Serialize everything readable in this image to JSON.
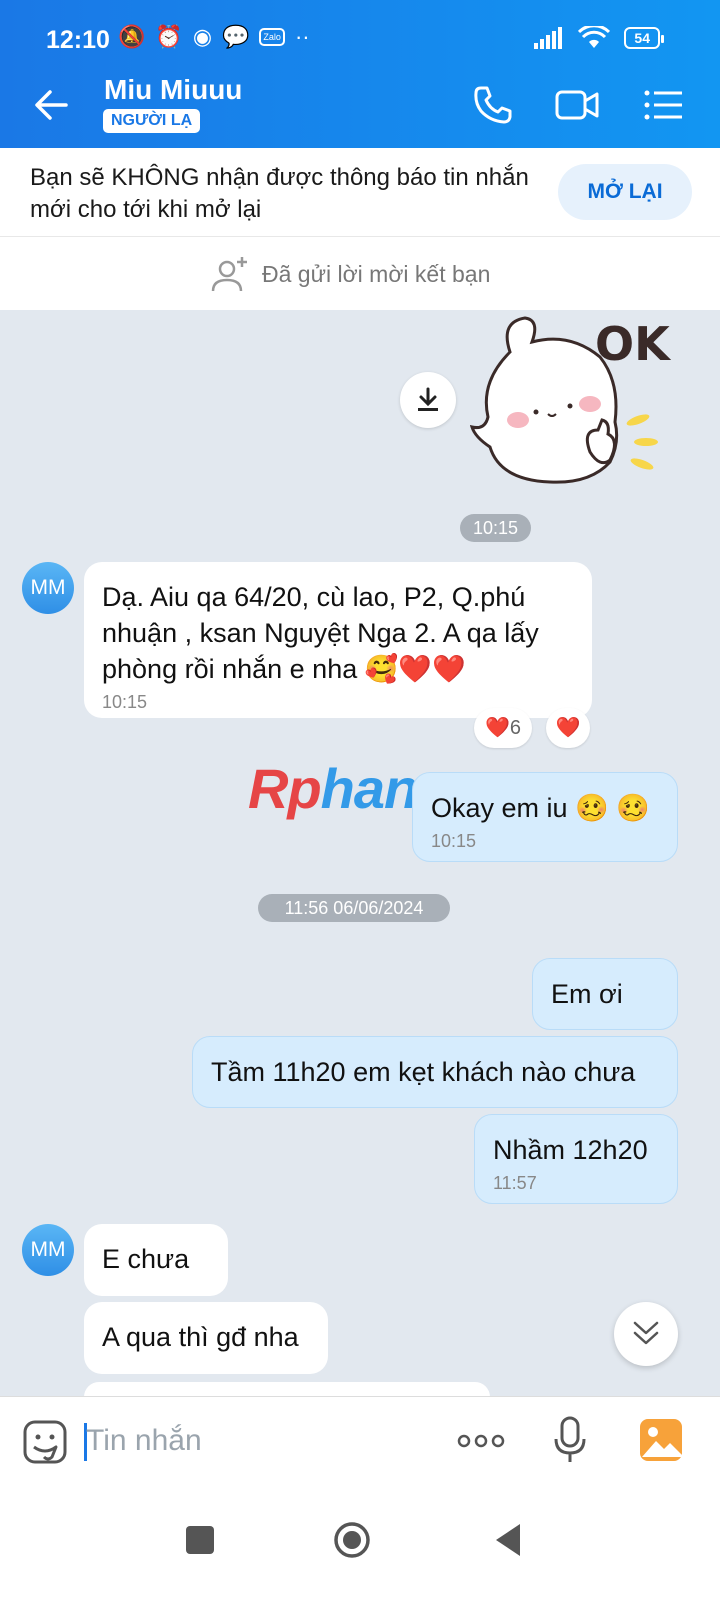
{
  "status_bar": {
    "time": "12:10",
    "battery": "54",
    "zalo": "Zalo"
  },
  "header": {
    "name": "Miu Miuuu",
    "badge": "NGƯỜI LẠ"
  },
  "notice": {
    "text": "Bạn sẽ KHÔNG nhận được thông báo tin nhắn mới cho tới khi mở lại",
    "button": "MỞ LẠI"
  },
  "friend_request": {
    "text": "Đã gửi lời mời kết bạn"
  },
  "sticker": {
    "label": "OK"
  },
  "avatar_initials": "MM",
  "messages": {
    "sep1": "10:15",
    "m1": {
      "text": "Dạ. Aiu qa 64/20, cù lao, P2, Q.phú nhuận , ksan Nguyệt Nga 2.  A qa lấy phòng rồi nhắn e nha 🥰❤️❤️",
      "time": "10:15"
    },
    "reaction1": {
      "emoji": "❤️",
      "count": "6"
    },
    "reaction2": {
      "emoji": "❤️"
    },
    "m2": {
      "text": "Okay em iu 🥴 🥴",
      "time": "10:15"
    },
    "sep2": "11:56 06/06/2024",
    "m3": {
      "text": "Em ơi"
    },
    "m4": {
      "text": "Tầm 11h20 em kẹt khách nào chưa"
    },
    "m5": {
      "text": "Nhầm 12h20",
      "time": "11:57"
    },
    "m6": {
      "text": "E chưa"
    },
    "m7": {
      "text": "A qua thì gđ nha"
    }
  },
  "watermark": {
    "part1": "Rp",
    "part2": "hang"
  },
  "composer": {
    "placeholder": "Tin nhắn"
  },
  "colors": {
    "header": "#1a78e6",
    "outgoing_bubble": "#d6ecfd",
    "background": "#e2e8ef"
  }
}
